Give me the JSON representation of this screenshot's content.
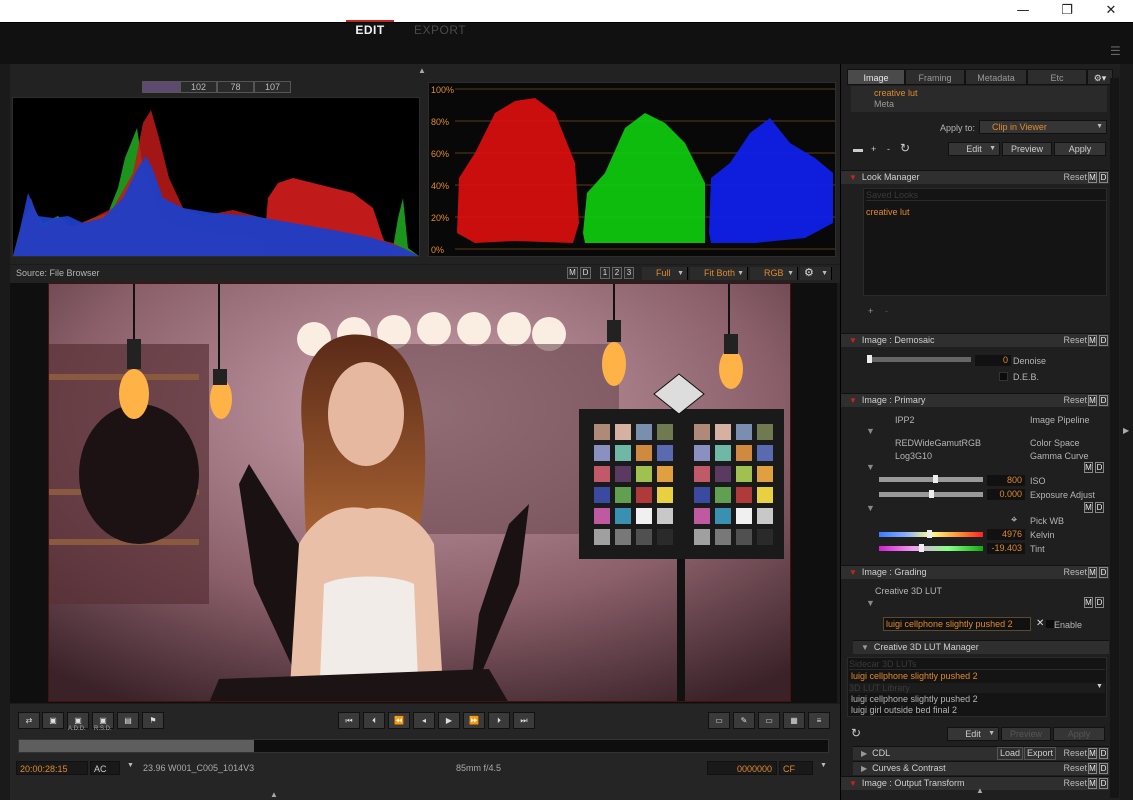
{
  "window": {
    "minimize": "—",
    "maximize": "❐",
    "close": "✕"
  },
  "nav": {
    "edit": "EDIT",
    "export": "EXPORT"
  },
  "scopes": {
    "rgb_values": [
      "102",
      "78",
      "107"
    ],
    "parade_scale": [
      "100%",
      "80%",
      "60%",
      "40%",
      "20%",
      "0%"
    ]
  },
  "viewer_bar": {
    "source": "Source: File Browser",
    "m": "M",
    "d": "D",
    "slots": [
      "1",
      "2",
      "3"
    ],
    "resolution": "Full",
    "fit": "Fit Both",
    "channel": "RGB"
  },
  "transport": {
    "tool_labels": [
      "A.D.D.",
      "R.S.D."
    ],
    "timecode": "20:00:28:15",
    "tc_mode": "AC",
    "clip_info": "23.96 W001_C005_1014V3",
    "lens": "85mm  f/4.5",
    "frame_counter": "0000000",
    "counter_mode": "CF",
    "playback_progress": 0.29
  },
  "panel": {
    "tabs": [
      "Image",
      "Framing",
      "Metadata",
      "Etc"
    ],
    "presets": [
      "creative lut",
      "Meta"
    ],
    "apply_to_label": "Apply to:",
    "apply_to_value": "Clip in Viewer",
    "edit_btn": "Edit",
    "preview_btn": "Preview",
    "apply_btn": "Apply",
    "reset": "Reset",
    "look_manager": {
      "title": "Look Manager",
      "saved_header": "Saved Looks",
      "item": "creative lut"
    },
    "demosaic": {
      "title": "Image : Demosaic",
      "denoise_value": "0",
      "denoise_label": "Denoise",
      "deb_label": "D.E.B."
    },
    "primary": {
      "title": "Image : Primary",
      "pipeline_value": "IPP2",
      "pipeline_label": "Image Pipeline",
      "color_space_value": "REDWideGamutRGB",
      "color_space_label": "Color Space",
      "gamma_value": "Log3G10",
      "gamma_label": "Gamma Curve",
      "iso_value": "800",
      "iso_label": "ISO",
      "exposure_value": "0.000",
      "exposure_label": "Exposure Adjust",
      "pickwb_label": "Pick WB",
      "kelvin_value": "4976",
      "kelvin_label": "Kelvin",
      "tint_value": "-19.403",
      "tint_label": "Tint"
    },
    "grading": {
      "title": "Image : Grading",
      "creative_label": "Creative 3D LUT",
      "lut_value": "luigi cellphone slightly pushed 2",
      "enable_label": "Enable"
    },
    "lut_manager": {
      "title": "Creative 3D LUT Manager",
      "sidecar_header": "Sidecar 3D LUTs",
      "sidecar_item": "luigi cellphone slightly pushed 2",
      "library_header": "3D LUT Library",
      "library_items": [
        "luigi cellphone slightly pushed 2",
        "luigi girl outside bed final 2"
      ]
    },
    "cdl": {
      "title": "CDL",
      "load": "Load",
      "export": "Export"
    },
    "curves": {
      "title": "Curves & Contrast"
    },
    "output": {
      "title": "Image : Output Transform"
    }
  },
  "colors": {
    "accent": "#e08a2e",
    "active_red": "#c8241e"
  }
}
